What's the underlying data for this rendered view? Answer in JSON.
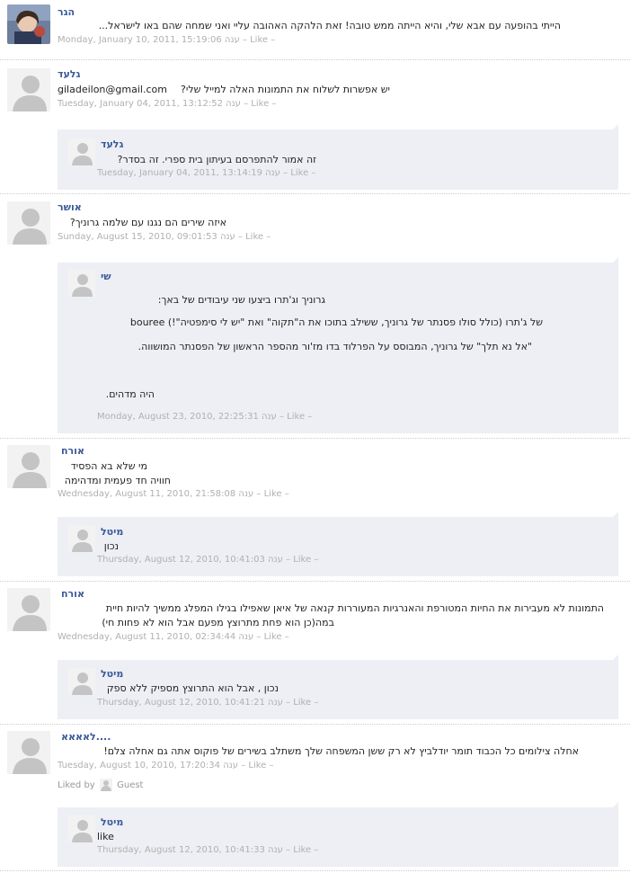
{
  "comments": [
    {
      "name": "הגר",
      "text_lines": [
        "הייתי בהופעה עם אבא שלי, והיא הייתה ממש טובה! זאת הלהקה האהובה עליי ואני שמחה שהם באו לישראל..."
      ],
      "date": "Monday, January 10, 2011, 15:19:06",
      "reply_label": "ענה",
      "like_label": "Like",
      "dash": "–"
    },
    {
      "name": "גלעד",
      "email": "giladeilon@gmail.com",
      "text_lines": [
        "יש אפשרות לשלוח את התמונות האלה למייל שלי?"
      ],
      "date": "Tuesday, January 04, 2011, 13:12:52",
      "reply_label": "ענה",
      "like_label": "Like",
      "dash": "–",
      "replies": [
        {
          "name": "גלעד",
          "text_lines": [
            "זה אמור להתפרסם בעיתון בית ספרי. זה בסדר?"
          ],
          "date": "Tuesday, January 04, 2011, 13:14:19",
          "reply_label": "ענה",
          "like_label": "Like",
          "dash": "–"
        }
      ]
    },
    {
      "name": "אושר",
      "text_lines": [
        "איזה שירים הם נגנו עם שלמה גרוניך?"
      ],
      "date": "Sunday, August 15, 2010, 09:01:53",
      "reply_label": "ענה",
      "like_label": "Like",
      "dash": "–",
      "replies": [
        {
          "name": "שי",
          "text_lines": [
            "גרוניך וג'תרו ביצעו שני עיבודים של באך:",
            "bouree של ג'תרו (כולל סולו פסנתר של גרוניך, ששילב בתוכו את ה\"תקוה\" ואת \"יש לי סימפטיה\"!)",
            "\"אל נא תלך\" של גרוניך, המבוסס על הפרלוד בדו מז'ור מהספר הראשון של הפסנתר המושווה.",
            "היה מדהים."
          ],
          "date": "Monday, August 23, 2010, 22:25:31",
          "reply_label": "ענה",
          "like_label": "Like",
          "dash": "–"
        }
      ]
    },
    {
      "name": "אורח",
      "text_lines": [
        "מי שלא בא הפסיד",
        "חוויה חד פעמית ומדהימה"
      ],
      "date": "Wednesday, August 11, 2010, 21:58:08",
      "reply_label": "ענה",
      "like_label": "Like",
      "dash": "–",
      "replies": [
        {
          "name": "מיטל",
          "text_lines": [
            "נכון"
          ],
          "date": "Thursday, August 12, 2010, 10:41:03",
          "reply_label": "ענה",
          "like_label": "Like",
          "dash": "–"
        }
      ]
    },
    {
      "name": "אורח",
      "text_lines": [
        "התמונות לא מעבירות את החיות המטורפת והאנרגיות המעוררות קנאה של איאן שאפילו בגילו המפלג ממשיך להיות חיית",
        "במה(כן הוא פחת מתרוצץ מפעם אבל הוא לא פחות חי)"
      ],
      "date": "Wednesday, August 11, 2010, 02:34:44",
      "reply_label": "ענה",
      "like_label": "Like",
      "dash": "–",
      "replies": [
        {
          "name": "מיטל",
          "text_lines": [
            "נכון , אבל הוא התרוצץ מספיק ללא ספק"
          ],
          "date": "Thursday, August 12, 2010, 10:41:21",
          "reply_label": "ענה",
          "like_label": "Like",
          "dash": "–"
        }
      ]
    },
    {
      "name": "לאאאא....",
      "text_lines": [
        "אחלה צילומים כל הכבוד תומר יודלביץ לא רק ששן המשפחה שלך משתלב בשירים של פוקוס אתה גם אחלה צלם!"
      ],
      "date": "Tuesday, August 10, 2010, 17:20:34",
      "reply_label": "ענה",
      "like_label": "Like",
      "dash": "–",
      "liked_by": "Liked by",
      "liked_user": "Guest",
      "replies": [
        {
          "name": "מיטל",
          "text_lines": [
            "like"
          ],
          "date": "Thursday, August 12, 2010, 10:41:33",
          "reply_label": "ענה",
          "like_label": "Like",
          "dash": "–"
        }
      ]
    }
  ],
  "colors": {
    "name": "#3b5998",
    "reply_bg": "#edeff4",
    "meta": "#b0b0b0"
  }
}
